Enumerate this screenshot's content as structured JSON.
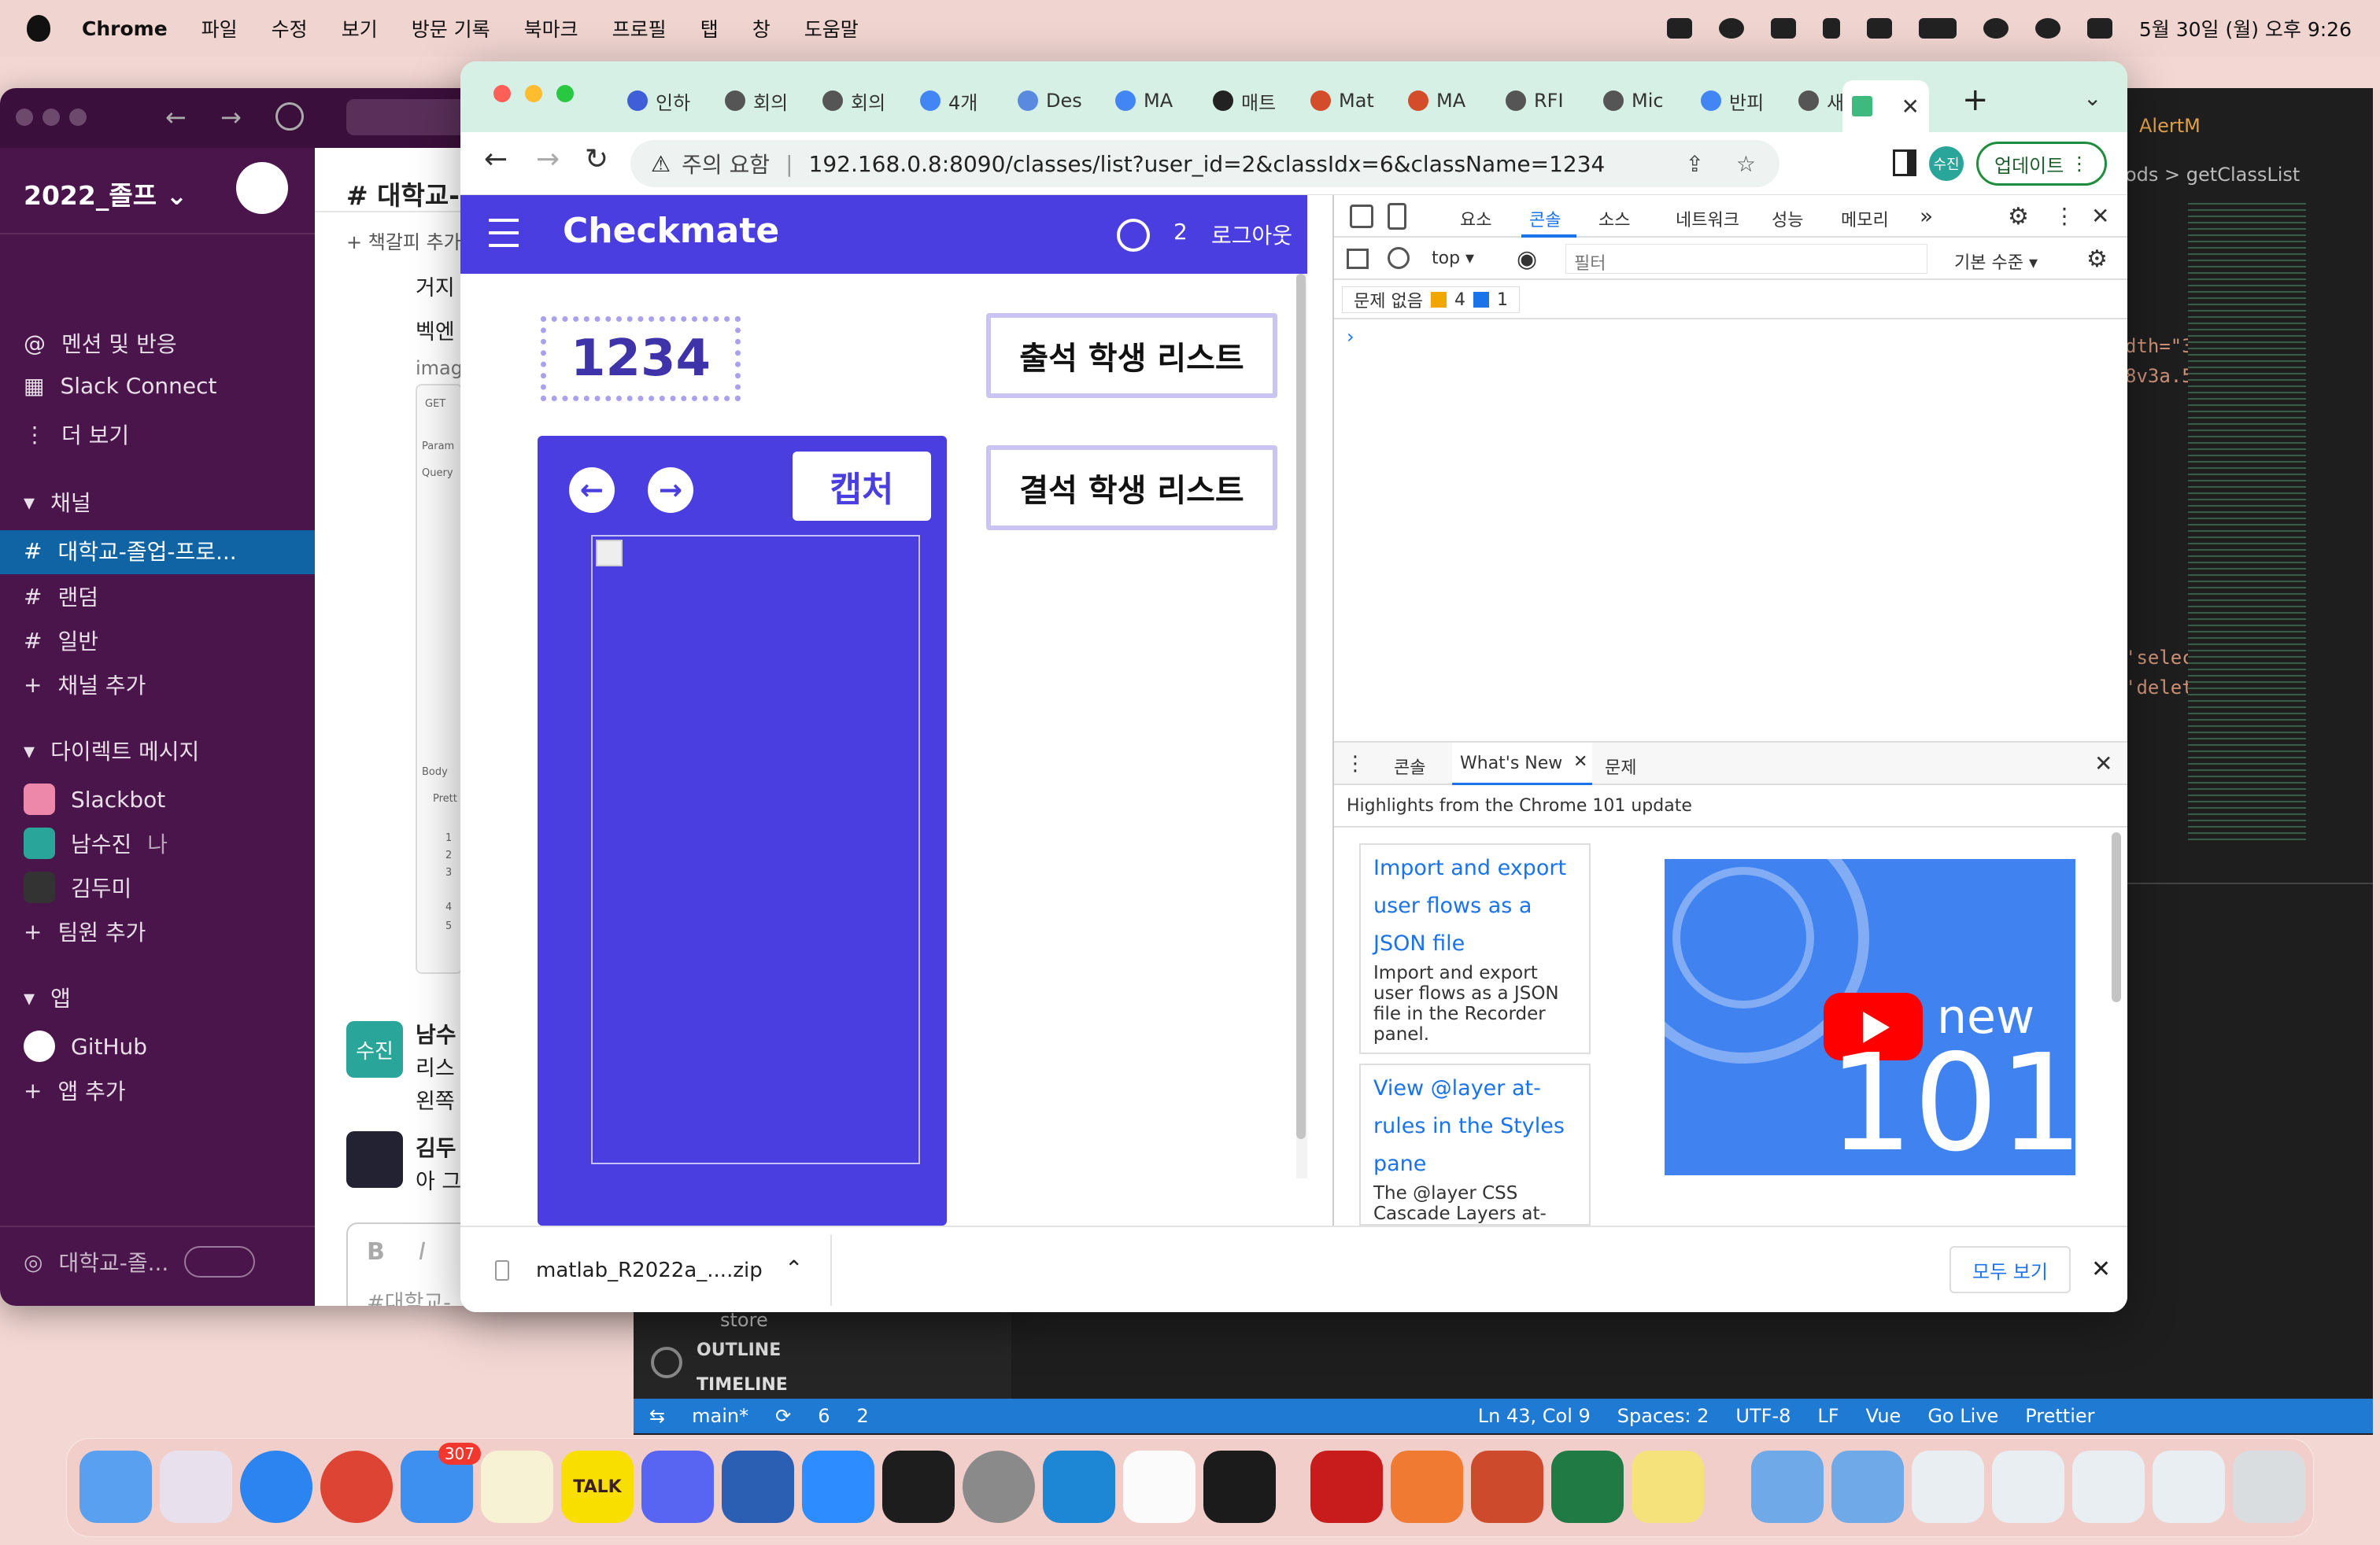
{
  "menubar": {
    "app": "Chrome",
    "items": [
      "파일",
      "수정",
      "보기",
      "방문 기록",
      "북마크",
      "프로필",
      "탭",
      "창",
      "도움말"
    ],
    "datetime": "5월 30일 (월) 오후 9:26"
  },
  "slack": {
    "workspace": "2022_졸프",
    "nav": [
      {
        "icon": "at-icon",
        "label": "멘션 및 반응"
      },
      {
        "icon": "building-icon",
        "label": "Slack Connect"
      },
      {
        "icon": "more-icon",
        "label": "더 보기"
      }
    ],
    "channels_header": "채널",
    "channels": [
      {
        "label": "대학교-졸업-프로..."
      },
      {
        "label": "랜덤"
      },
      {
        "label": "일반"
      }
    ],
    "add_channel": "채널 추가",
    "dm_header": "다이렉트 메시지",
    "dms": [
      {
        "label": "Slackbot",
        "suffix": ""
      },
      {
        "label": "남수진",
        "suffix": "나"
      },
      {
        "label": "김두미",
        "suffix": ""
      }
    ],
    "add_member": "팀원 추가",
    "apps_header": "앱",
    "apps": [
      {
        "label": "GitHub"
      }
    ],
    "add_app": "앱 추가",
    "huddle_label": "대학교-졸...",
    "main": {
      "channel_title": "# 대학교-",
      "bookmark": "+ 책갈피 추가",
      "lines": [
        "거지",
        "벡엔",
        "image"
      ],
      "postman": [
        "GET",
        "Param",
        "Query",
        "Body",
        "Prett",
        "1",
        "2",
        "3",
        "4",
        "5"
      ],
      "msg1_avatar": "수진",
      "msg1_name": "남수",
      "msg1_lines": [
        "리스",
        "왼쪽"
      ],
      "msg2_name": "김두",
      "msg2_text": "아 그",
      "composer_placeholder": "#대학교-",
      "bold": "B",
      "italic": "I"
    }
  },
  "chrome": {
    "tabs": [
      "인하",
      "회의",
      "회의",
      "4개",
      "Des",
      "MA",
      "매트",
      "Mat",
      "MA",
      "RFI",
      "Mic",
      "반피",
      "새 탭"
    ],
    "warning": "주의 요함",
    "url": "192.168.0.8:8090/classes/list?user_id=2&classIdx=6&className=1234",
    "profile": "수진",
    "update": "업데이트"
  },
  "app": {
    "title": "Checkmate",
    "user_count": "2",
    "logout": "로그아웃",
    "class_name": "1234",
    "capture": "캡처",
    "attend_btn": "출석 학생 리스트",
    "absent_btn": "결석 학생 리스트",
    "brand_color": "#4a3ee0"
  },
  "devtools": {
    "tabs": [
      "요소",
      "콘솔",
      "소스",
      "네트워크",
      "성능",
      "메모리"
    ],
    "context": "top",
    "filter": "필터",
    "level": "기본 수준",
    "issues": "문제 없음",
    "warn_count": "4",
    "info_count": "1",
    "drawer_tabs": [
      "콘솔",
      "What's New",
      "문제"
    ],
    "highlights": "Highlights from the Chrome 101 update",
    "cards": [
      {
        "title": "Import and export user flows as a JSON file",
        "body": "Import and export user flows as a JSON file in the Recorder panel."
      },
      {
        "title": "View @layer at-rules in the Styles pane",
        "body": "The @layer CSS Cascade Layers at-rules are now displayed in the"
      }
    ],
    "promo_new": "new",
    "promo_ver": "101"
  },
  "download": {
    "file": "matlab_R2022a_....zip",
    "show_all": "모두 보기"
  },
  "vscode": {
    "breadcrumb": "ods > getClassList",
    "tab": "AlertM",
    "code": [
      "dth=\"3",
      "8v3a.5",
      "'selec",
      "'delet"
    ],
    "tree": [
      "store",
      "OUTLINE",
      "TIMELINE"
    ],
    "status": {
      "branch": "main*",
      "errors": "6",
      "warnings": "2",
      "position": "Ln 43, Col 9",
      "spaces": "Spaces: 2",
      "encoding": "UTF-8",
      "eol": "LF",
      "lang": "Vue",
      "golive": "Go Live",
      "prettier": "Prettier"
    }
  },
  "dock": {
    "mail_badge": "307",
    "talk": "TALK"
  }
}
